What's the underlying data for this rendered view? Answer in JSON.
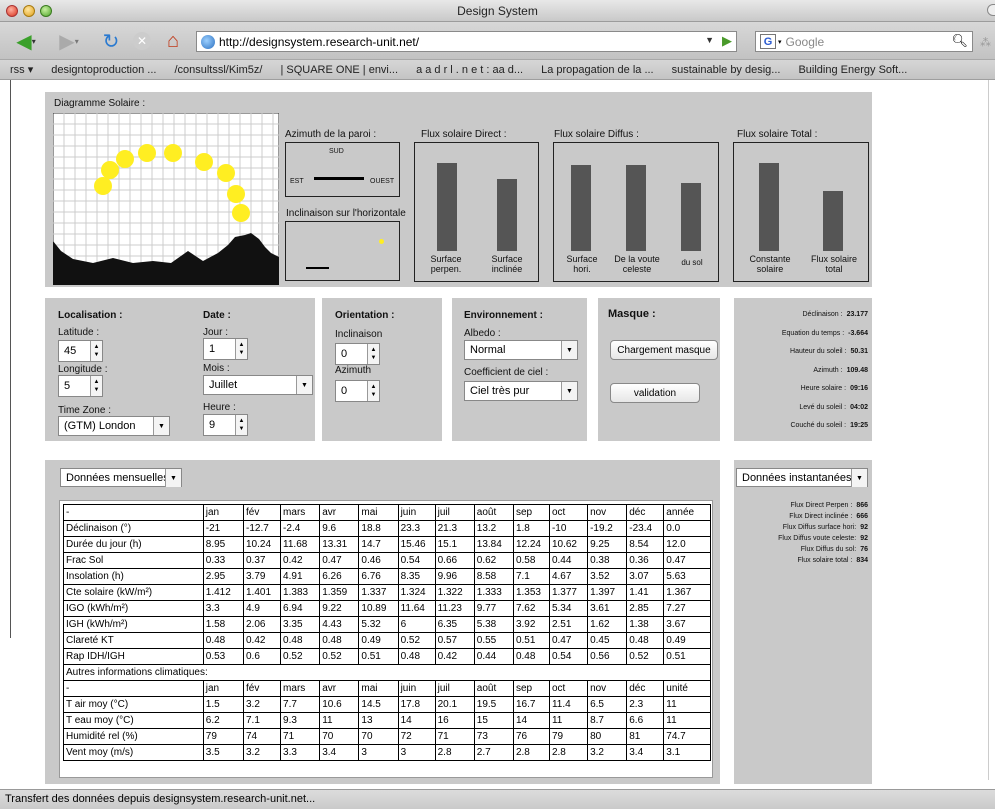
{
  "window": {
    "title": "Design System"
  },
  "nav": {
    "url": "http://designsystem.research-unit.net/",
    "search_placeholder": "Google",
    "search_engine_icon": "G"
  },
  "bookmarks": [
    "rss ▾",
    "designtoproduction ...",
    "/consultssl/Kim5z/",
    "| SQUARE ONE | envi...",
    "a a d r l . n e t : aa d...",
    "La propagation de la ...",
    "sustainable by desig...",
    "Building Energy Soft..."
  ],
  "sun_panel": {
    "title": "Diagramme Solaire :",
    "azimuth_label": "Azimuth de la paroi :",
    "sud": "SUD",
    "est": "EST",
    "ouest": "OUEST",
    "inclinaison_label": "Inclinaison sur l'horizontale",
    "direct": {
      "title": "Flux solaire Direct :",
      "labels": [
        "Surface perpen.",
        "Surface inclinée"
      ],
      "levels": [
        0.88,
        0.72
      ]
    },
    "diffus": {
      "title": "Flux solaire Diffus :",
      "labels": [
        "Surface hori.",
        "De la voute celeste",
        "du sol"
      ],
      "levels": [
        0.86,
        0.86,
        0.68
      ]
    },
    "total": {
      "title": "Flux solaire Total :",
      "labels": [
        "Constante solaire",
        "Flux solaire total"
      ],
      "levels": [
        0.88,
        0.6
      ]
    }
  },
  "controls": {
    "localisation": {
      "title": "Localisation :",
      "latitude_label": "Latitude :",
      "latitude": "45",
      "longitude_label": "Longitude :",
      "longitude": "5",
      "tz_label": "Time Zone :",
      "tz": "(GTM) London"
    },
    "date": {
      "title": "Date :",
      "jour_label": "Jour :",
      "jour": "1",
      "mois_label": "Mois :",
      "mois": "Juillet",
      "heure_label": "Heure :",
      "heure": "9"
    },
    "orientation": {
      "title": "Orientation :",
      "inclinaison_label": "Inclinaison",
      "inclinaison": "0",
      "azimuth_label": "Azimuth",
      "azimuth": "0"
    },
    "environnement": {
      "title": "Environnement :",
      "albedo_label": "Albedo :",
      "albedo": "Normal",
      "coef_label": "Coefficient de ciel :",
      "coef": "Ciel très pur"
    },
    "masque": {
      "title": "Masque :",
      "load_button": "Chargement masque",
      "validate_button": "validation"
    }
  },
  "solar_info": [
    {
      "label": "Déclinaison :",
      "value": "23.177"
    },
    {
      "label": "Equation du temps :",
      "value": "-3.664"
    },
    {
      "label": "Hauteur du soleil :",
      "value": "50.31"
    },
    {
      "label": "Azimuth :",
      "value": "109.48"
    },
    {
      "label": "Heure solaire :",
      "value": "09:16"
    },
    {
      "label": "Levé du soleil :",
      "value": "04:02"
    },
    {
      "label": "Couché du soleil :",
      "value": "19:25"
    }
  ],
  "monthly": {
    "selector": "Données mensuelles",
    "header": [
      "-",
      "jan",
      "fév",
      "mars",
      "avr",
      "mai",
      "juin",
      "juil",
      "août",
      "sep",
      "oct",
      "nov",
      "déc",
      "année"
    ],
    "rows": [
      [
        "Déclinaison (°)",
        "-21",
        "-12.7",
        "-2.4",
        "9.6",
        "18.8",
        "23.3",
        "21.3",
        "13.2",
        "1.8",
        "-10",
        "-19.2",
        "-23.4",
        "0.0"
      ],
      [
        "Durée du jour (h)",
        "8.95",
        "10.24",
        "11.68",
        "13.31",
        "14.7",
        "15.46",
        "15.1",
        "13.84",
        "12.24",
        "10.62",
        "9.25",
        "8.54",
        "12.0"
      ],
      [
        "Frac Sol",
        "0.33",
        "0.37",
        "0.42",
        "0.47",
        "0.46",
        "0.54",
        "0.66",
        "0.62",
        "0.58",
        "0.44",
        "0.38",
        "0.36",
        "0.47"
      ],
      [
        "Insolation (h)",
        "2.95",
        "3.79",
        "4.91",
        "6.26",
        "6.76",
        "8.35",
        "9.96",
        "8.58",
        "7.1",
        "4.67",
        "3.52",
        "3.07",
        "5.63"
      ],
      [
        "Cte solaire (kW/m²)",
        "1.412",
        "1.401",
        "1.383",
        "1.359",
        "1.337",
        "1.324",
        "1.322",
        "1.333",
        "1.353",
        "1.377",
        "1.397",
        "1.41",
        "1.367"
      ],
      [
        "IGO (kWh/m²)",
        "3.3",
        "4.9",
        "6.94",
        "9.22",
        "10.89",
        "11.64",
        "11.23",
        "9.77",
        "7.62",
        "5.34",
        "3.61",
        "2.85",
        "7.27"
      ],
      [
        "IGH (kWh/m²)",
        "1.58",
        "2.06",
        "3.35",
        "4.43",
        "5.32",
        "6",
        "6.35",
        "5.38",
        "3.92",
        "2.51",
        "1.62",
        "1.38",
        "3.67"
      ],
      [
        "Clareté KT",
        "0.48",
        "0.42",
        "0.48",
        "0.48",
        "0.49",
        "0.52",
        "0.57",
        "0.55",
        "0.51",
        "0.47",
        "0.45",
        "0.48",
        "0.49"
      ],
      [
        "Rap IDH/IGH",
        "0.53",
        "0.6",
        "0.52",
        "0.52",
        "0.51",
        "0.48",
        "0.42",
        "0.44",
        "0.48",
        "0.54",
        "0.56",
        "0.52",
        "0.51"
      ]
    ],
    "other_title": "Autres informations climatiques:",
    "header2": [
      "-",
      "jan",
      "fév",
      "mars",
      "avr",
      "mai",
      "juin",
      "juil",
      "août",
      "sep",
      "oct",
      "nov",
      "déc",
      "unité"
    ],
    "rows2": [
      [
        "T air moy (°C)",
        "1.5",
        "3.2",
        "7.7",
        "10.6",
        "14.5",
        "17.8",
        "20.1",
        "19.5",
        "16.7",
        "11.4",
        "6.5",
        "2.3",
        "11"
      ],
      [
        "T eau moy (°C)",
        "6.2",
        "7.1",
        "9.3",
        "11",
        "13",
        "14",
        "16",
        "15",
        "14",
        "11",
        "8.7",
        "6.6",
        "11"
      ],
      [
        "Humidité rel (%)",
        "79",
        "74",
        "71",
        "70",
        "70",
        "72",
        "71",
        "73",
        "76",
        "79",
        "80",
        "81",
        "74.7"
      ],
      [
        "Vent moy (m/s)",
        "3.5",
        "3.2",
        "3.3",
        "3.4",
        "3",
        "3",
        "2.8",
        "2.7",
        "2.8",
        "2.8",
        "3.2",
        "3.4",
        "3.1"
      ]
    ]
  },
  "instant": {
    "selector": "Données instantanées",
    "rows": [
      {
        "label": "Flux Direct Perpen :",
        "value": "866"
      },
      {
        "label": "Flux Direct inclinée :",
        "value": "666"
      },
      {
        "label": "Flux Diffus surface hori:",
        "value": "92"
      },
      {
        "label": "Flux Diffus voute celeste:",
        "value": "92"
      },
      {
        "label": "Flux Diffus du sol:",
        "value": "76"
      },
      {
        "label": "Flux solaire total :",
        "value": "834"
      }
    ]
  },
  "status": "Transfert des données depuis designsystem.research-unit.net..."
}
